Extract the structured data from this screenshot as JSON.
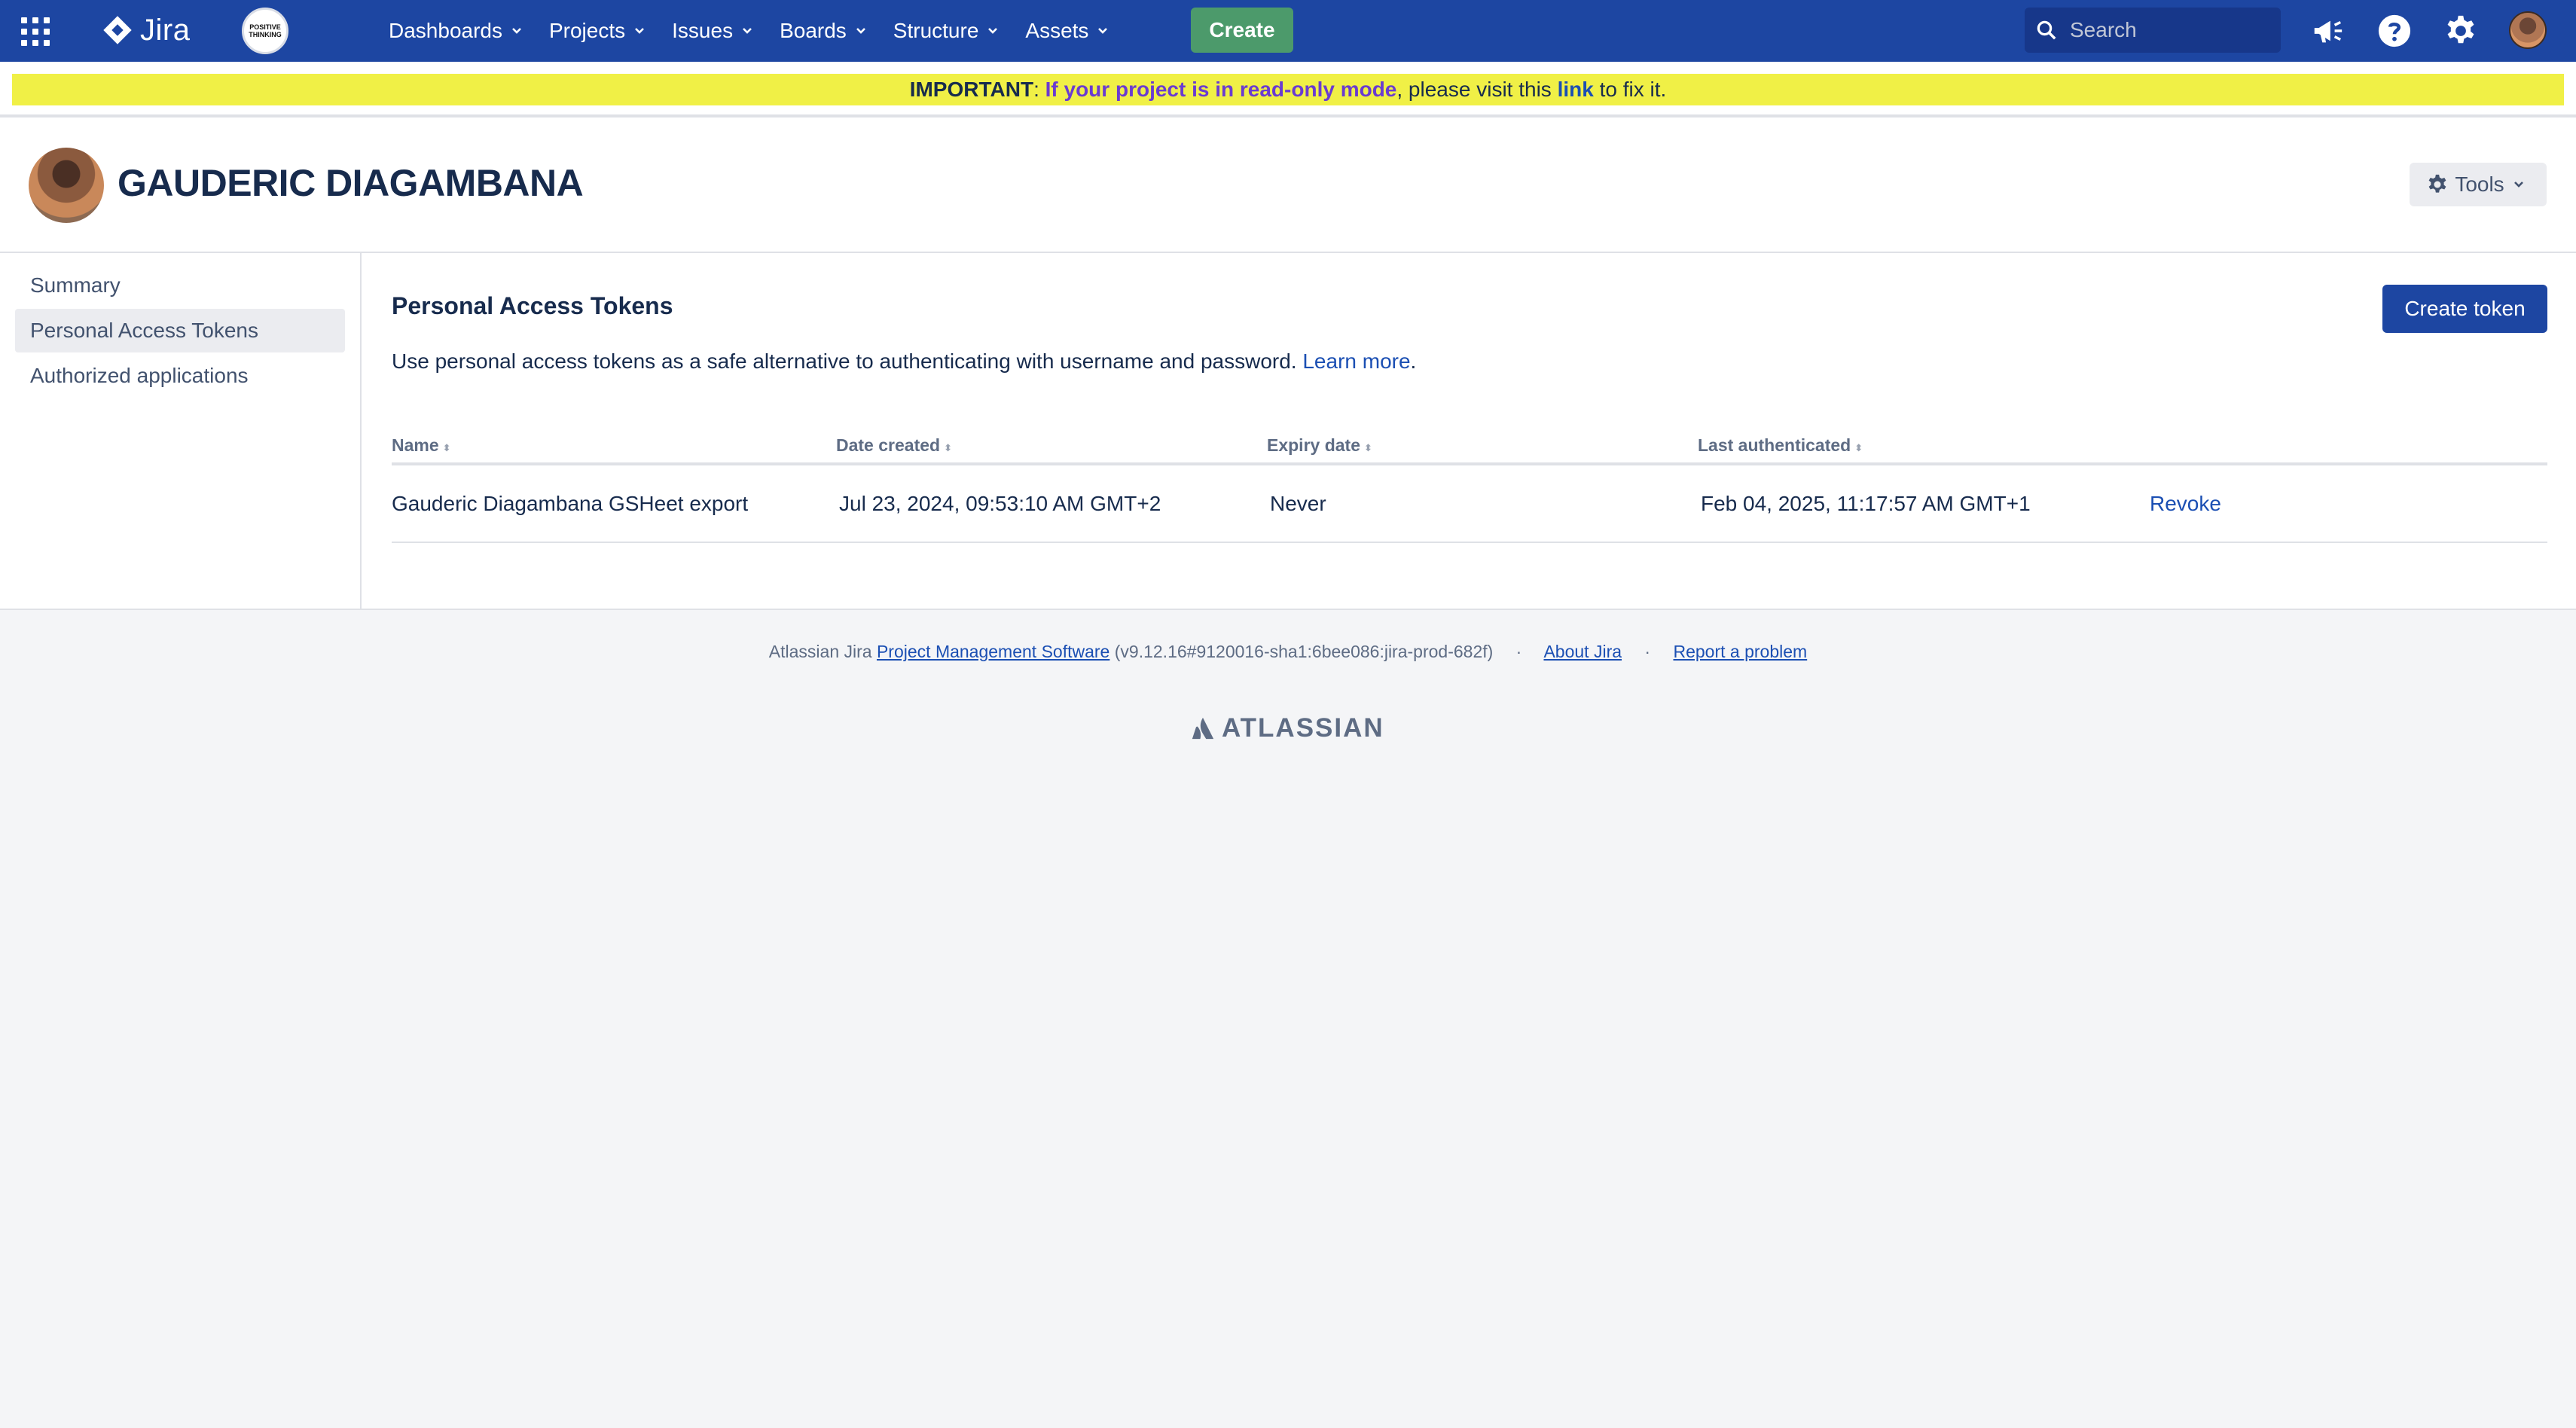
{
  "topnav": {
    "product_name": "Jira",
    "org_logo_text": "POSITIVE THINKING",
    "items": [
      {
        "label": "Dashboards"
      },
      {
        "label": "Projects"
      },
      {
        "label": "Issues"
      },
      {
        "label": "Boards"
      },
      {
        "label": "Structure"
      },
      {
        "label": "Assets"
      }
    ],
    "create_label": "Create",
    "search_placeholder": "Search",
    "icons": [
      "app-switcher-icon",
      "jira-logo-icon",
      "megaphone-icon",
      "help-icon",
      "gear-icon",
      "avatar"
    ],
    "colors": {
      "nav_bg": "#1d46a2",
      "create_bg": "#4c9a6b"
    }
  },
  "banner": {
    "important": "IMPORTANT",
    "colon": ": ",
    "warning": "If your project is in read-only mode",
    "middle": ", please visit this ",
    "link": "link",
    "end": " to fix it.",
    "bg_color": "#f0f046"
  },
  "profile": {
    "name": "GAUDERIC DIAGAMBANA",
    "tools_label": "Tools"
  },
  "sidebar": {
    "items": [
      {
        "label": "Summary",
        "active": false
      },
      {
        "label": "Personal Access Tokens",
        "active": true
      },
      {
        "label": "Authorized applications",
        "active": false
      }
    ]
  },
  "main": {
    "title": "Personal Access Tokens",
    "create_token_label": "Create token",
    "description": "Use personal access tokens as a safe alternative to authenticating with username and password. ",
    "learn_more": "Learn more",
    "desc_end": ".",
    "table": {
      "columns": [
        "Name",
        "Date created",
        "Expiry date",
        "Last authenticated"
      ],
      "rows": [
        {
          "name": "Gauderic Diagambana GSHeet export",
          "date_created": "Jul 23, 2024, 09:53:10 AM GMT+2",
          "expiry": "Never",
          "last_auth": "Feb 04, 2025, 11:17:57 AM GMT+1",
          "action": "Revoke"
        }
      ]
    }
  },
  "footer": {
    "prefix": "Atlassian Jira ",
    "pm_link": "Project Management Software",
    "version": " (v9.12.16#9120016-sha1:6bee086:jira-prod-682f)",
    "dot": "·",
    "about": "About Jira",
    "report": "Report a problem",
    "brand": "ATLASSIAN"
  }
}
